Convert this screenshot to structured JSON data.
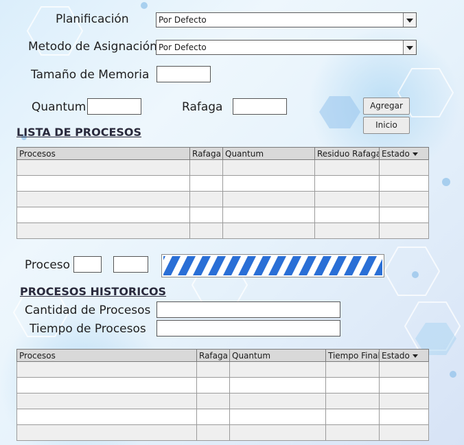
{
  "config": {
    "planificacion_label": "Planificación",
    "planificacion_value": "Por Defecto",
    "asignacion_label": "Metodo de Asignación",
    "asignacion_value": "Por Defecto",
    "memoria_label": "Tamaño de Memoria",
    "memoria_value": "",
    "quantum_label": "Quantum",
    "quantum_value": "",
    "rafaga_label": "Rafaga",
    "rafaga_value": "",
    "agregar_label": "Agregar",
    "inicio_label": "Inicio"
  },
  "lista": {
    "title": "LISTA DE PROCESOS",
    "columns": [
      "Procesos",
      "Rafaga",
      "Quantum",
      "Residuo Rafaga",
      "Estado"
    ],
    "rows": [
      [
        "",
        "",
        "",
        "",
        ""
      ],
      [
        "",
        "",
        "",
        "",
        ""
      ],
      [
        "",
        "",
        "",
        "",
        ""
      ],
      [
        "",
        "",
        "",
        "",
        ""
      ],
      [
        "",
        "",
        "",
        "",
        ""
      ]
    ]
  },
  "proceso": {
    "label": "Proceso",
    "field1": "",
    "field2": ""
  },
  "historicos": {
    "title": "PROCESOS HISTORICOS",
    "cantidad_label": "Cantidad de Procesos",
    "cantidad_value": "",
    "tiempo_label": "Tiempo de Procesos",
    "tiempo_value": "",
    "columns": [
      "Procesos",
      "Rafaga",
      "Quantum",
      "Tiempo Final",
      "Estado"
    ],
    "rows": [
      [
        "",
        "",
        "",
        "",
        ""
      ],
      [
        "",
        "",
        "",
        "",
        ""
      ],
      [
        "",
        "",
        "",
        "",
        ""
      ],
      [
        "",
        "",
        "",
        "",
        ""
      ],
      [
        "",
        "",
        "",
        "",
        ""
      ]
    ]
  },
  "colors": {
    "progress": "#2a6fd6",
    "grid_header": "#d9d9d9"
  }
}
